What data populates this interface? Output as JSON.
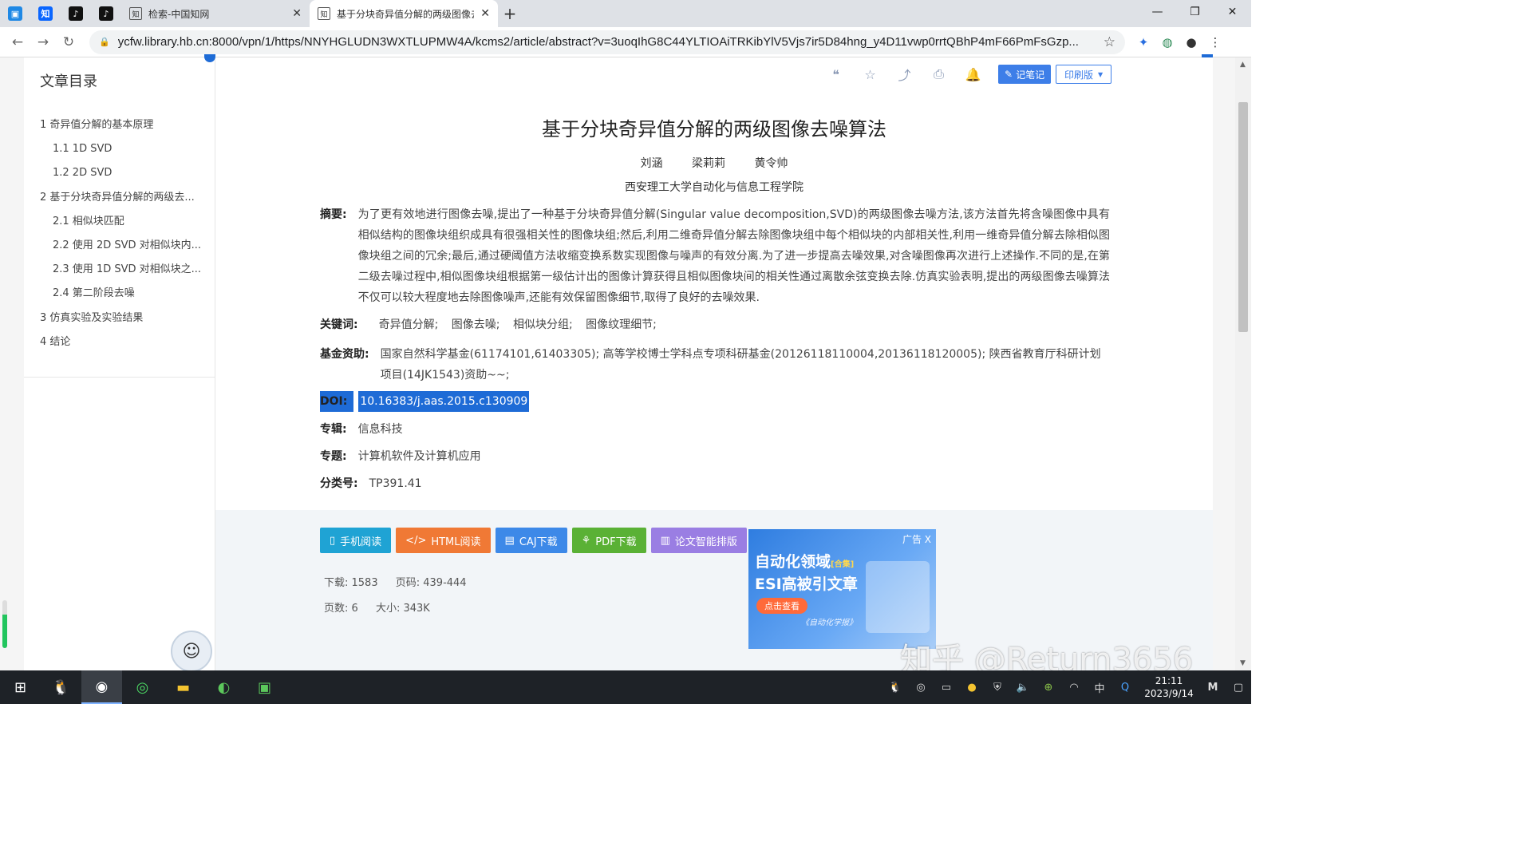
{
  "browser": {
    "pinned_tabs": [
      {
        "icon": "bilibili-icon",
        "glyph": "▣",
        "color": "#1e88e5"
      },
      {
        "icon": "zhihu-icon",
        "glyph": "知",
        "color": "#0a66ff"
      },
      {
        "icon": "douyin-icon",
        "glyph": "♪",
        "color": "#111111"
      },
      {
        "icon": "douyin-icon",
        "glyph": "♪",
        "color": "#111111"
      }
    ],
    "tabs": [
      {
        "title": "检索-中国知网",
        "active": false
      },
      {
        "title": "基于分块奇异值分解的两级图像去",
        "active": true
      }
    ],
    "url": "ycfw.library.hb.cn:8000/vpn/1/https/NNYHGLUDN3WXTLUPMW4A/kcms2/article/abstract?v=3uoqIhG8C44YLTIOAiTRKibYlV5Vjs7ir5D84hng_y4D11vwp0rrtQBhP4mF66PmFsGzp..."
  },
  "sidebar": {
    "title": "文章目录",
    "toc": [
      {
        "label": "1 奇异值分解的基本原理",
        "level": 1
      },
      {
        "label": "1.1 1D SVD",
        "level": 2
      },
      {
        "label": "1.2 2D SVD",
        "level": 2
      },
      {
        "label": "2 基于分块奇异值分解的两级去...",
        "level": 1
      },
      {
        "label": "2.1 相似块匹配",
        "level": 2
      },
      {
        "label": "2.2 使用 2D SVD 对相似块内...",
        "level": 2
      },
      {
        "label": "2.3 使用 1D SVD 对相似块之...",
        "level": 2
      },
      {
        "label": "2.4 第二阶段去噪",
        "level": 2
      },
      {
        "label": "3 仿真实验及实验结果",
        "level": 1
      },
      {
        "label": "4 结论",
        "level": 1
      }
    ]
  },
  "toolbar": {
    "note_label": "记笔记",
    "print_label": "印刷版"
  },
  "article": {
    "title": "基于分块奇异值分解的两级图像去噪算法",
    "authors": [
      "刘涵",
      "梁莉莉",
      "黄令帅"
    ],
    "affiliation": "西安理工大学自动化与信息工程学院",
    "abstract_label": "摘要:",
    "abstract": "为了更有效地进行图像去噪,提出了一种基于分块奇异值分解(Singular value decomposition,SVD)的两级图像去噪方法,该方法首先将含噪图像中具有相似结构的图像块组织成具有很强相关性的图像块组;然后,利用二维奇异值分解去除图像块组中每个相似块的内部相关性,利用一维奇异值分解去除相似图像块组之间的冗余;最后,通过硬阈值方法收缩变换系数实现图像与噪声的有效分离.为了进一步提高去噪效果,对含噪图像再次进行上述操作.不同的是,在第二级去噪过程中,相似图像块组根据第一级估计出的图像计算获得且相似图像块间的相关性通过离散余弦变换去除.仿真实验表明,提出的两级图像去噪算法不仅可以较大程度地去除图像噪声,还能有效保留图像细节,取得了良好的去噪效果.",
    "keywords_label": "关键词:",
    "keywords": [
      "奇异值分解;",
      "图像去噪;",
      "相似块分组;",
      "图像纹理细节;"
    ],
    "fund_label": "基金资助:",
    "fund": "国家自然科学基金(61174101,61403305);  高等学校博士学科点专项科研基金(20126118110004,20136118120005);  陕西省教育厅科研计划项目(14JK1543)资助~~;",
    "doi_label": "DOI:",
    "doi": "10.16383/j.aas.2015.c130909",
    "series_label": "专辑:",
    "series": "信息科技",
    "topic_label": "专题:",
    "topic": "计算机软件及计算机应用",
    "class_label": "分类号:",
    "class": "TP391.41"
  },
  "downloads": [
    {
      "label": "手机阅读",
      "icon": "phone-icon",
      "color": "#1fa3d4"
    },
    {
      "label": "HTML阅读",
      "icon": "code-icon",
      "color": "#f07935"
    },
    {
      "label": "CAJ下载",
      "icon": "book-icon",
      "color": "#3d89e8"
    },
    {
      "label": "PDF下载",
      "icon": "pdf-icon",
      "color": "#5ab135"
    },
    {
      "label": "论文智能排版",
      "icon": "layout-icon",
      "color": "#9a7ee3"
    }
  ],
  "stats": {
    "downloads": "下载: 1583",
    "pages_range": "页码: 439-444",
    "page_count": "页数: 6",
    "size": "大小: 343K"
  },
  "ad": {
    "tag": "广告 X",
    "line1": "自动化领域",
    "line1_small": "[合集]",
    "line2": "ESI高被引文章",
    "cta": "点击查看",
    "foot": "《自动化学报》"
  },
  "watermark": "知乎 @Return3656",
  "taskbar": {
    "time": "21:11",
    "date": "2023/9/14",
    "ime": "中"
  }
}
